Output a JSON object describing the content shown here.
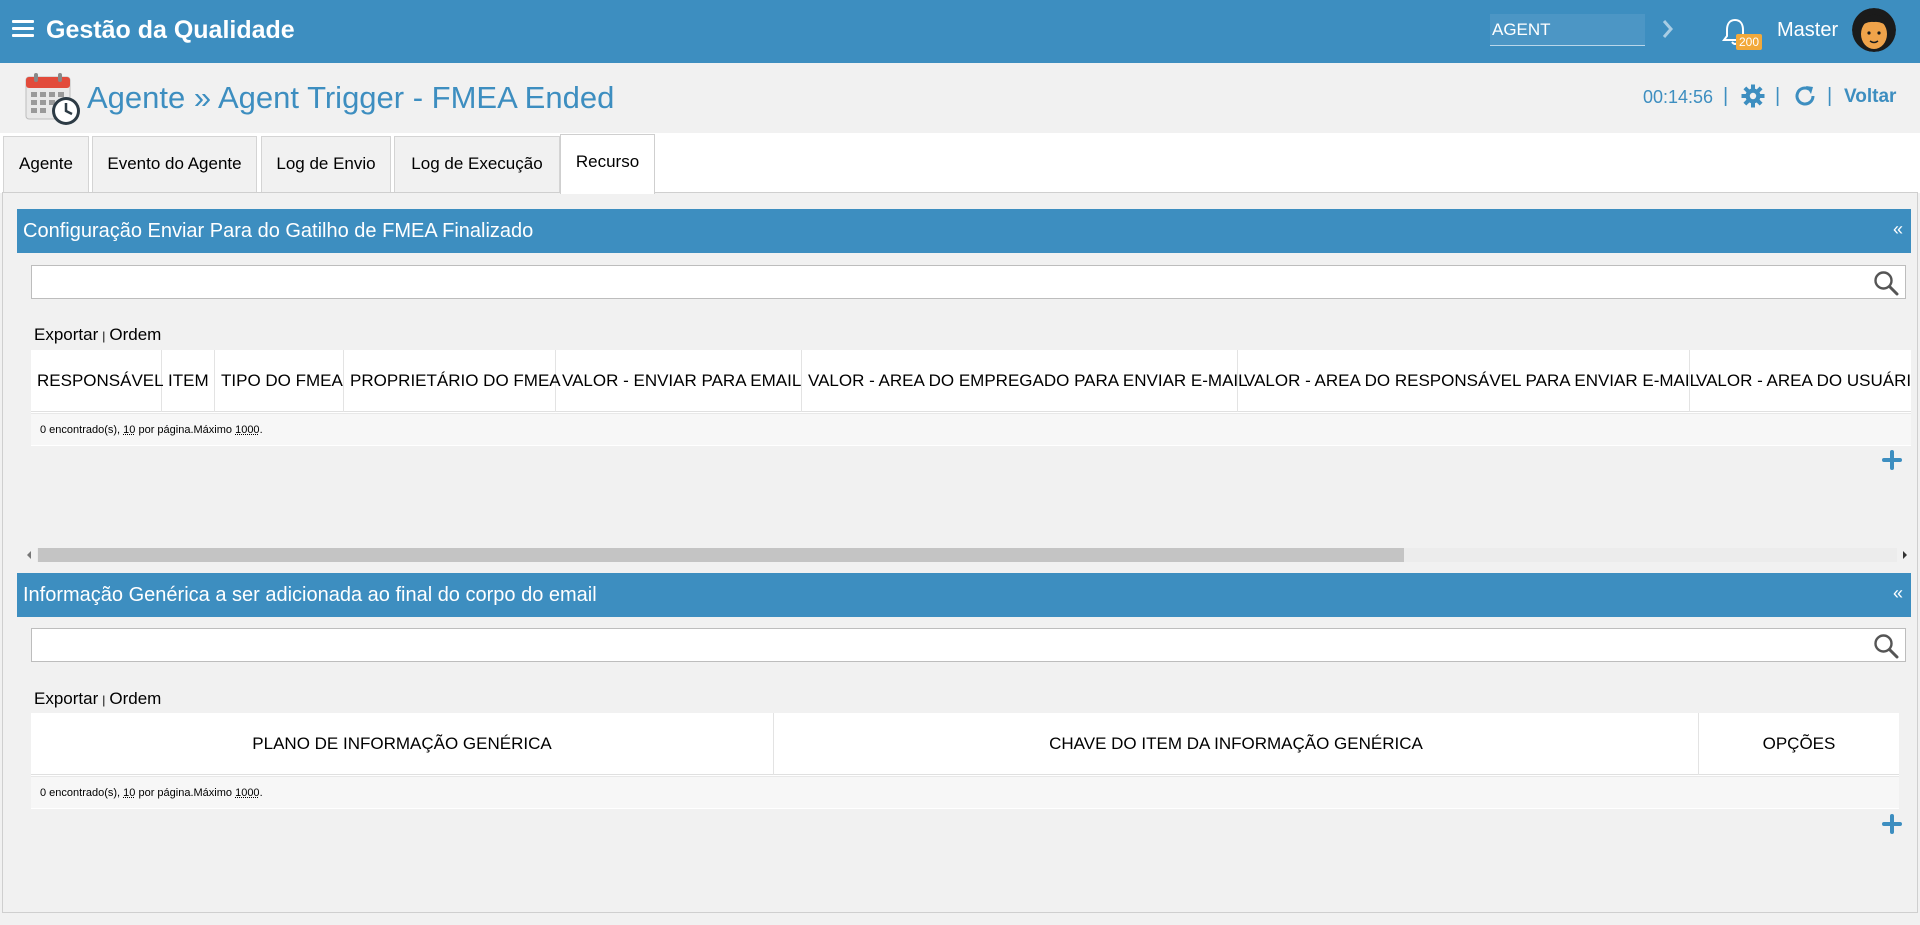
{
  "topbar": {
    "app_title": "Gestão da Qualidade",
    "agent_value": "AGENT",
    "notification_count": "200",
    "user_name": "Master"
  },
  "header": {
    "breadcrumb": "Agente » Agent Trigger - FMEA Ended",
    "timer": "00:14:56",
    "separator": "|",
    "back_label": "Voltar"
  },
  "tabs": [
    {
      "label": "Agente",
      "active": false
    },
    {
      "label": "Evento do Agente",
      "active": false
    },
    {
      "label": "Log de Envio",
      "active": false
    },
    {
      "label": "Log de Execução",
      "active": false
    },
    {
      "label": "Recurso",
      "active": true
    }
  ],
  "panel1": {
    "title": "Configuração Enviar Para do Gatilho de FMEA Finalizado",
    "collapse_label": "«",
    "export_label": "Exportar",
    "toolbar_sep": "|",
    "order_label": "Ordem",
    "columns": [
      "RESPONSÁVEL",
      "ITEM",
      "TIPO DO FMEA",
      "PROPRIETÁRIO DO FMEA",
      "VALOR - ENVIAR PARA EMAIL",
      "VALOR - AREA DO EMPREGADO PARA ENVIAR E-MAIL",
      "VALOR - AREA DO RESPONSÁVEL PARA ENVIAR E-MAIL",
      "VALOR - AREA DO USUÁRIO"
    ],
    "footer": {
      "prefix": "0 encontrado(s), ",
      "per_page": "10",
      "middle": " por página.Máximo ",
      "max": "1000",
      "suffix": "."
    }
  },
  "panel2": {
    "title": "Informação Genérica a ser adicionada ao final do corpo do email",
    "collapse_label": "«",
    "export_label": "Exportar",
    "toolbar_sep": "|",
    "order_label": "Ordem",
    "columns": [
      "PLANO DE INFORMAÇÃO GENÉRICA",
      "CHAVE DO ITEM DA INFORMAÇÃO GENÉRICA",
      "OPÇÕES"
    ],
    "footer": {
      "prefix": "0 encontrado(s), ",
      "per_page": "10",
      "middle": " por página.Máximo ",
      "max": "1000",
      "suffix": "."
    }
  },
  "colors": {
    "brand": "#3d8ec0",
    "badge": "#f2a93b"
  }
}
